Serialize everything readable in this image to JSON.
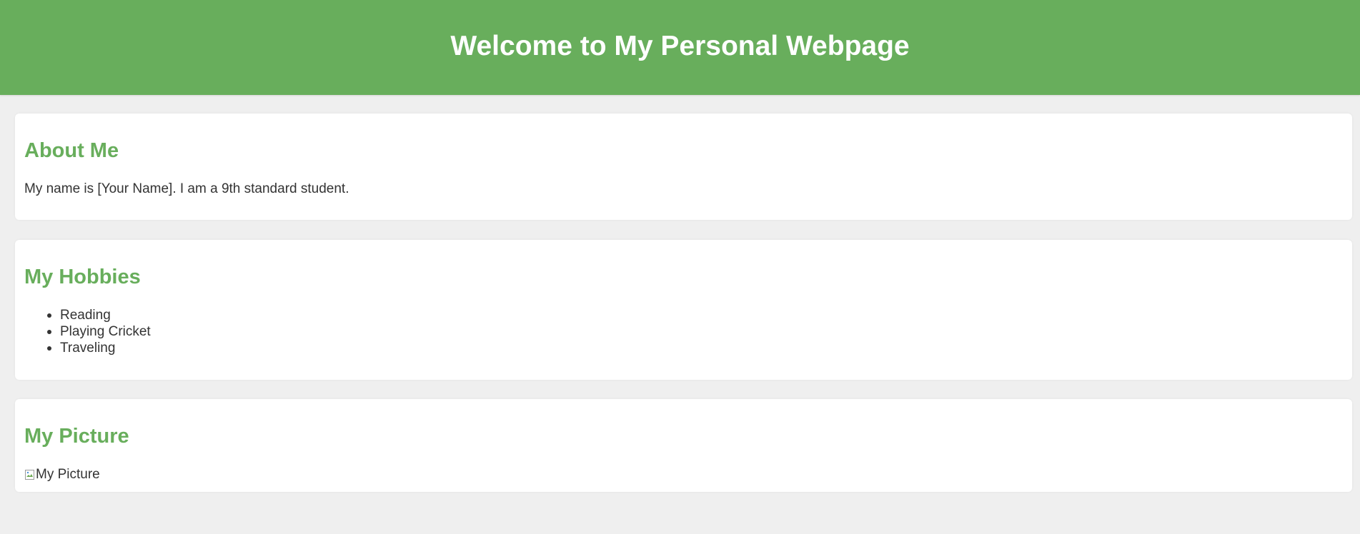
{
  "header": {
    "title": "Welcome to My Personal Webpage"
  },
  "about": {
    "heading": "About Me",
    "text": "My name is [Your Name]. I am a 9th standard student."
  },
  "hobbies": {
    "heading": "My Hobbies",
    "items": [
      "Reading",
      "Playing Cricket",
      "Traveling"
    ]
  },
  "picture": {
    "heading": "My Picture",
    "alt_text": "My Picture"
  },
  "colors": {
    "accent": "#68ae5c",
    "background": "#efefef",
    "text": "#333333",
    "card": "#ffffff"
  }
}
